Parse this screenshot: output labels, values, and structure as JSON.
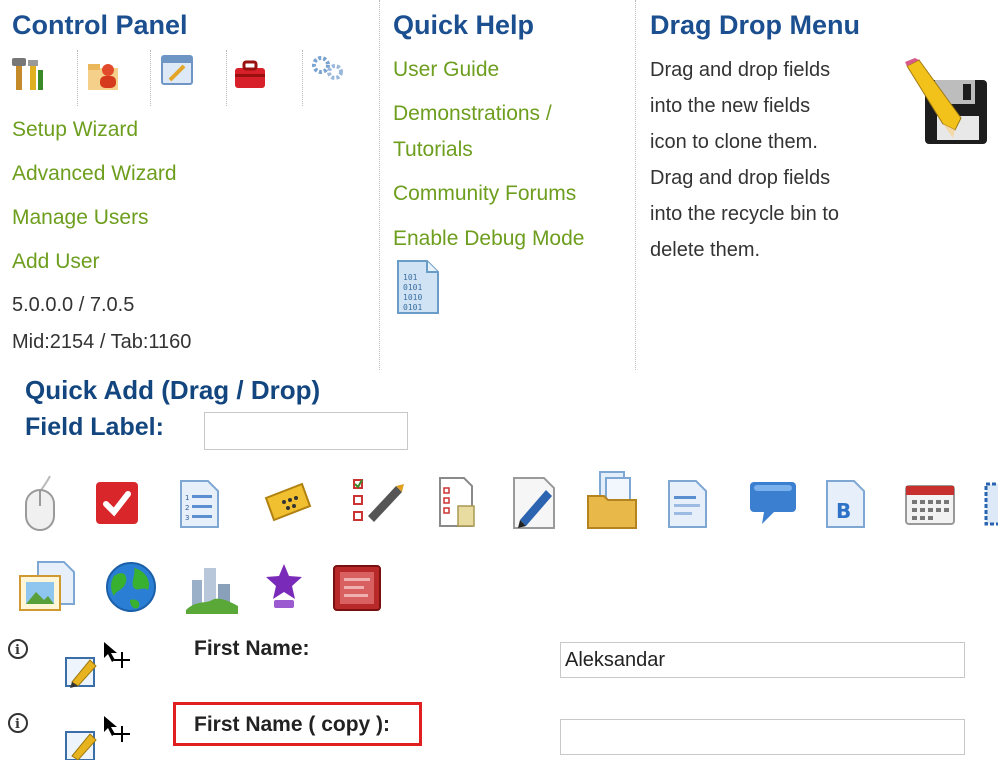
{
  "control_panel": {
    "title": "Control Panel",
    "icons": [
      "tools-icon",
      "user-folder-icon",
      "settings-window-icon",
      "toolbox-icon",
      "gears-icon"
    ],
    "links": [
      "Setup Wizard",
      "Advanced Wizard",
      "Manage Users",
      "Add User"
    ],
    "version": "5.0.0.0 / 7.0.5",
    "ids": "Mid:2154 / Tab:1160"
  },
  "quick_help": {
    "title": "Quick Help",
    "links": [
      "User Guide",
      "Demonstrations /",
      "Tutorials",
      "Community Forums",
      "Enable Debug Mode"
    ],
    "debug_icon": "binary-file-icon"
  },
  "drag_drop_menu": {
    "title": "Drag Drop Menu",
    "lines": [
      "Drag and drop fields",
      "into the new fields",
      "icon to clone them.",
      "Drag and drop fields",
      "into the recycle bin to",
      "delete them."
    ],
    "icon": "save-pencil-icon"
  },
  "quick_add": {
    "title": "Quick Add (Drag / Drop)",
    "field_label": "Field Label:",
    "field_value": "",
    "row1_icons": [
      "mouse-icon",
      "checkbox-icon",
      "numbered-list-icon",
      "ticket-icon",
      "checklist-icon",
      "document-checklist-icon",
      "edit-pencil-icon",
      "folder-files-icon",
      "text-document-icon",
      "speech-bubble-icon",
      "bold-text-icon",
      "calendar-icon",
      "frame-icon"
    ],
    "row2_icons": [
      "image-file-icon",
      "globe-icon",
      "city-icon",
      "star-icon",
      "screen-icon"
    ]
  },
  "fields": [
    {
      "label": "First Name:",
      "value": "Aleksandar"
    },
    {
      "label": "First Name ( copy ):",
      "value": ""
    }
  ],
  "colors": {
    "heading": "#1b4f8f",
    "link": "#6d9e1e",
    "highlight": "#e02020"
  }
}
